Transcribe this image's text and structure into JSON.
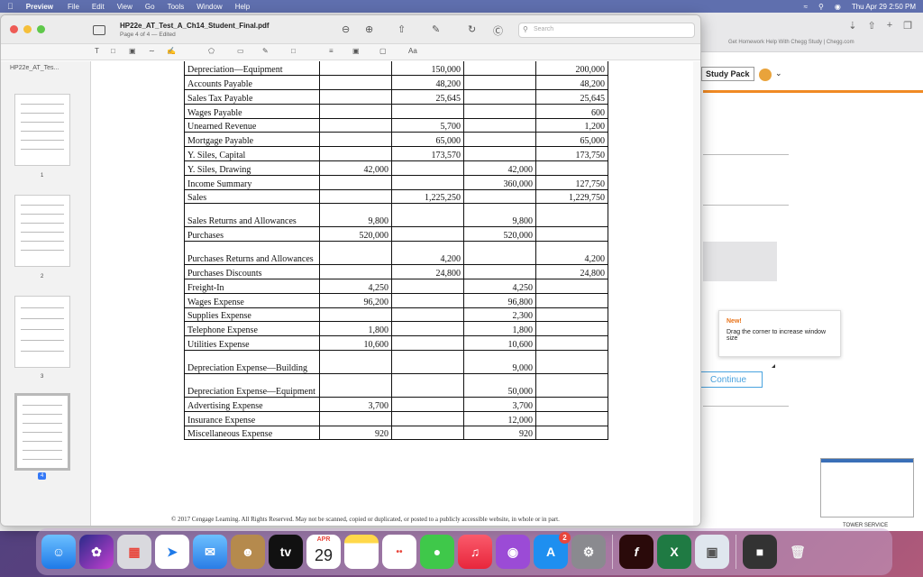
{
  "menubar": {
    "app": "Preview",
    "items": [
      "File",
      "Edit",
      "View",
      "Go",
      "Tools",
      "Window",
      "Help"
    ],
    "datetime": "Thu Apr 29  2:50 PM"
  },
  "browser": {
    "tab_title": "Get Homework Help With Chegg Study | Chegg.com",
    "study_pack": "Study Pack",
    "tooltip_new": "New!",
    "tooltip_text": "Drag the corner to increase window size",
    "continue_label": "Continue",
    "tower_text": "TOWER SERVICE"
  },
  "preview": {
    "doc_title": "HP22e_AT_Test_A_Ch14_Student_Final.pdf",
    "doc_sub": "Page 4 of 4 — Edited",
    "search_placeholder": "Search",
    "sidebar_filename": "HP22e_AT_Tes...",
    "page_numbers": [
      "1",
      "2",
      "3",
      "4"
    ],
    "selected_page": "4",
    "footer": "© 2017 Cengage Learning. All Rights Reserved. May not be scanned, copied or duplicated, or posted to a publicly accessible website, in whole or in part."
  },
  "ledger": {
    "rows": [
      {
        "account": "Depreciation—Equipment",
        "c1": "",
        "c2": "150,000",
        "c3": "",
        "c4": "200,000"
      },
      {
        "account": "Accounts Payable",
        "c1": "",
        "c2": "48,200",
        "c3": "",
        "c4": "48,200"
      },
      {
        "account": "Sales Tax Payable",
        "c1": "",
        "c2": "25,645",
        "c3": "",
        "c4": "25,645"
      },
      {
        "account": "Wages Payable",
        "c1": "",
        "c2": "",
        "c3": "",
        "c4": "600"
      },
      {
        "account": "Unearned Revenue",
        "c1": "",
        "c2": "5,700",
        "c3": "",
        "c4": "1,200"
      },
      {
        "account": "Mortgage Payable",
        "c1": "",
        "c2": "65,000",
        "c3": "",
        "c4": "65,000"
      },
      {
        "account": "Y. Siles, Capital",
        "c1": "",
        "c2": "173,570",
        "c3": "",
        "c4": "173,750"
      },
      {
        "account": "Y. Siles, Drawing",
        "c1": "42,000",
        "c2": "",
        "c3": "42,000",
        "c4": ""
      },
      {
        "account": "Income Summary",
        "c1": "",
        "c2": "",
        "c3": "360,000",
        "c4": "127,750"
      },
      {
        "account": "Sales",
        "c1": "",
        "c2": "1,225,250",
        "c3": "",
        "c4": "1,229,750"
      },
      {
        "account": "Sales Returns and Allowances",
        "c1": "9,800",
        "c2": "",
        "c3": "9,800",
        "c4": ""
      },
      {
        "account": "Purchases",
        "c1": "520,000",
        "c2": "",
        "c3": "520,000",
        "c4": ""
      },
      {
        "account": "Purchases Returns and Allowances",
        "c1": "",
        "c2": "4,200",
        "c3": "",
        "c4": "4,200"
      },
      {
        "account": "Purchases Discounts",
        "c1": "",
        "c2": "24,800",
        "c3": "",
        "c4": "24,800"
      },
      {
        "account": "Freight-In",
        "c1": "4,250",
        "c2": "",
        "c3": "4,250",
        "c4": ""
      },
      {
        "account": "Wages Expense",
        "c1": "96,200",
        "c2": "",
        "c3": "96,800",
        "c4": ""
      },
      {
        "account": "Supplies Expense",
        "c1": "",
        "c2": "",
        "c3": "2,300",
        "c4": ""
      },
      {
        "account": "Telephone Expense",
        "c1": "1,800",
        "c2": "",
        "c3": "1,800",
        "c4": ""
      },
      {
        "account": "Utilities Expense",
        "c1": "10,600",
        "c2": "",
        "c3": "10,600",
        "c4": ""
      },
      {
        "account": "Depreciation Expense—Building",
        "c1": "",
        "c2": "",
        "c3": "9,000",
        "c4": ""
      },
      {
        "account": "Depreciation Expense—Equipment",
        "c1": "",
        "c2": "",
        "c3": "50,000",
        "c4": ""
      },
      {
        "account": "Advertising Expense",
        "c1": "3,700",
        "c2": "",
        "c3": "3,700",
        "c4": ""
      },
      {
        "account": "Insurance Expense",
        "c1": "",
        "c2": "",
        "c3": "12,000",
        "c4": ""
      },
      {
        "account": "Miscellaneous Expense",
        "c1": "920",
        "c2": "",
        "c3": "920",
        "c4": ""
      }
    ]
  },
  "dock": {
    "apps": [
      "Finder",
      "Siri",
      "Launchpad",
      "Safari",
      "Mail",
      "Contacts",
      "TV",
      "Calendar",
      "Notes",
      "Reminders",
      "Messages",
      "Music",
      "Podcasts",
      "App Store",
      "System Preferences",
      "Flash",
      "Excel",
      "Preview",
      "Screenshot",
      "Trash"
    ],
    "calendar_month": "APR",
    "calendar_day": "29",
    "appstore_badge": "2",
    "tv_label": "tv",
    "excel_label": "X"
  }
}
